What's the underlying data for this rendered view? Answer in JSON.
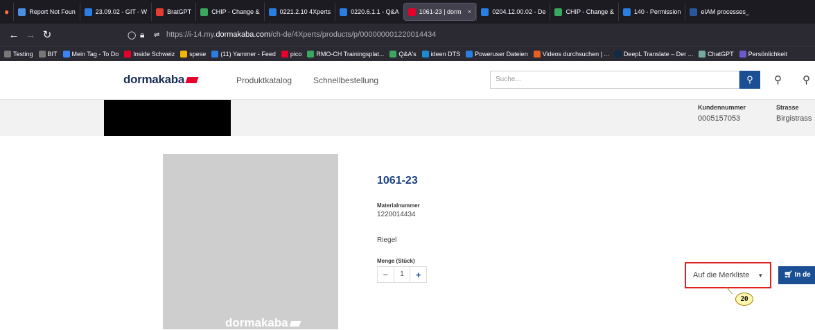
{
  "browser": {
    "tabs": [
      {
        "label": "Report Not Foun",
        "color": "#4a90e2"
      },
      {
        "label": "23.09.02 - GIT - W",
        "color": "#2a7de1"
      },
      {
        "label": "BratGPT",
        "color": "#e43d30"
      },
      {
        "label": "CHIP - Change &",
        "color": "#3aa760"
      },
      {
        "label": "0221.2.10 4Xperts",
        "color": "#2a7de1"
      },
      {
        "label": "0220.6.1.1 - Q&A",
        "color": "#2a7de1"
      },
      {
        "label": "1061-23 | dorm",
        "color": "#e4002b",
        "close": "×"
      },
      {
        "label": "0204.12.00.02 - De",
        "color": "#2a7de1"
      },
      {
        "label": "CHIP - Change &",
        "color": "#3aa760"
      },
      {
        "label": "140 - Permission",
        "color": "#2a7de1"
      },
      {
        "label": "eIAM processes_",
        "color": "#2b579a"
      }
    ],
    "url_prefix": "https://i-14.my.",
    "url_domain": "dormakaba.com",
    "url_path": "/ch-de/4Xperts/products/p/000000001220014434",
    "bookmarks": [
      {
        "label": "Testing",
        "color": "#777"
      },
      {
        "label": "BIT",
        "color": "#777"
      },
      {
        "label": "Mein Tag - To Do",
        "color": "#3b82f6"
      },
      {
        "label": "Inside Schweiz",
        "color": "#e4002b"
      },
      {
        "label": "spese",
        "color": "#f5b400"
      },
      {
        "label": "(11) Yammer - Feed",
        "color": "#2a7de1"
      },
      {
        "label": "pico",
        "color": "#e4002b"
      },
      {
        "label": "RMO-CH Trainingsplat...",
        "color": "#3aa760"
      },
      {
        "label": "Q&A's",
        "color": "#3aa760"
      },
      {
        "label": "ideen DTS",
        "color": "#1b8cd1"
      },
      {
        "label": "Poweruser Dateien",
        "color": "#2a7de1"
      },
      {
        "label": "Videos durchsuchen | ...",
        "color": "#e8601c"
      },
      {
        "label": "DeepL Translate – Der ...",
        "color": "#0f2b46"
      },
      {
        "label": "ChatGPT",
        "color": "#74aa9c"
      },
      {
        "label": "Persönlichkeit",
        "color": "#6a5acd"
      }
    ]
  },
  "header": {
    "logo": "dormakaba",
    "nav": [
      "Produktkatalog",
      "Schnellbestellung"
    ],
    "search_placeholder": "Suche..."
  },
  "customer": {
    "number_label": "Kundennummer",
    "number_value": "0005157053",
    "street_label": "Strasse",
    "street_value": "Birgistrass"
  },
  "product": {
    "name": "1061-23",
    "material_label": "Materialnummer",
    "material_value": "1220014434",
    "description": "Riegel",
    "qty_label": "Menge (Stück)",
    "qty_value": "1",
    "wishlist_label": "Auf die Merkliste",
    "cart_label": "In de",
    "image_logo": "dormakaba"
  },
  "annotation": {
    "step": "20",
    "color": "#e02020"
  }
}
